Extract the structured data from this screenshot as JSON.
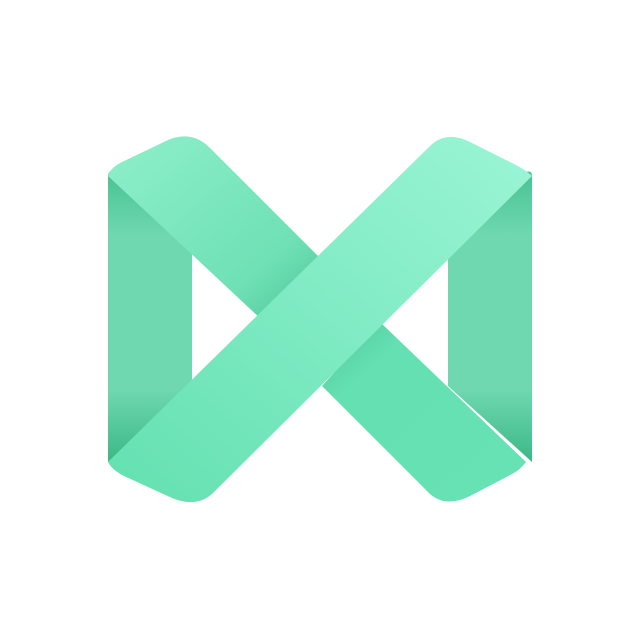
{
  "logo": {
    "icon": "ribbon-x-logo-icon",
    "colors": {
      "primary": "#64E3B4",
      "highlight": "#98F4D4",
      "side": "#6DD9B0",
      "shade": "#3DBA8A",
      "background": "#FFFFFF"
    }
  }
}
